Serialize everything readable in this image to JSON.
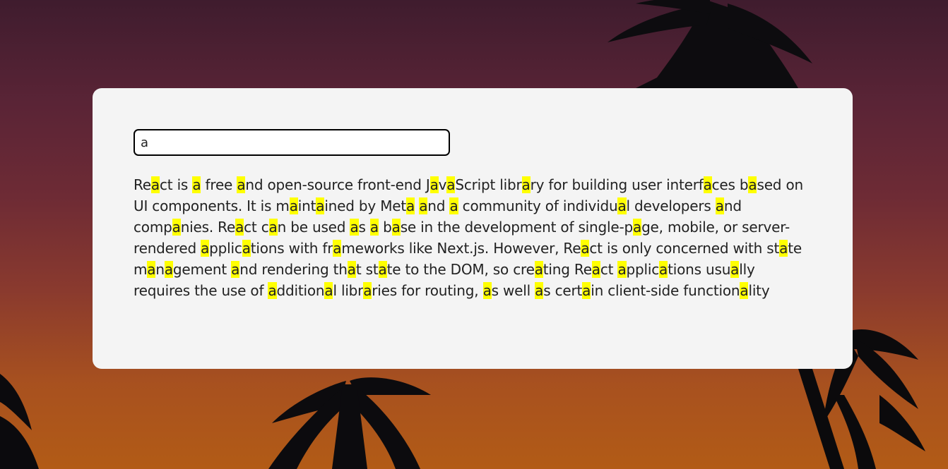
{
  "colors": {
    "highlight": "#ffff00",
    "card_background": "#f4f4f4",
    "text": "#222222",
    "input_border": "#000000"
  },
  "search": {
    "value": "a",
    "placeholder": ""
  },
  "content": {
    "paragraph": "React is a free and open-source front-end JavaScript library for building user interfaces based on UI components. It is maintained by Meta and a community of individual developers and companies. React can be used as a base in the development of single-page, mobile, or server-rendered applications with frameworks like Next.js. However, React is only concerned with state management and rendering that state to the DOM, so creating React applications usually requires the use of additional libraries for routing, as well as certain client-side functionality"
  },
  "background": {
    "icon": "palm-trees-sunset-image"
  }
}
